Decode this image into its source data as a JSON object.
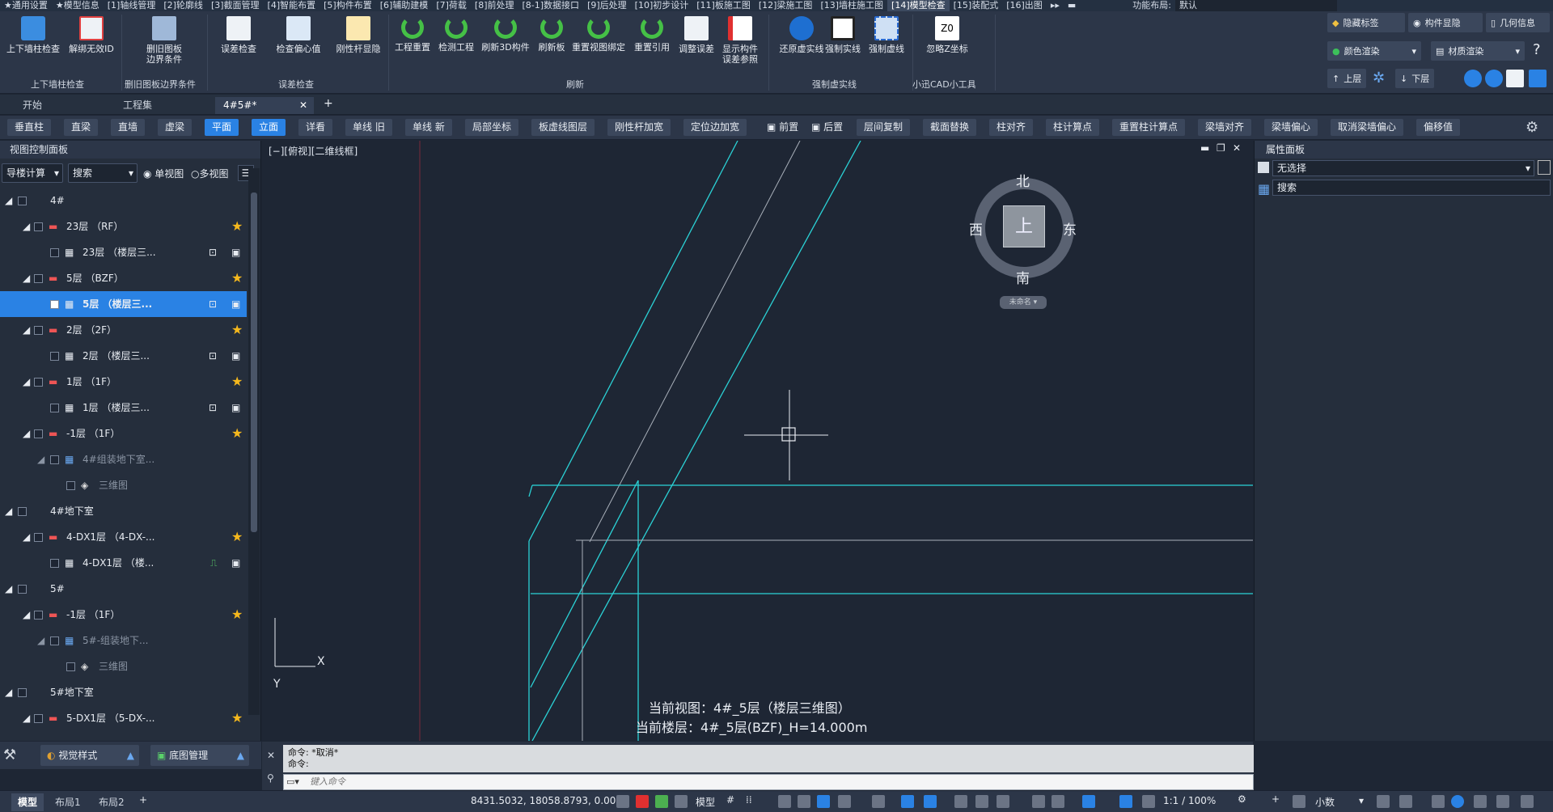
{
  "menu": [
    "★通用设置",
    "★模型信息",
    "[1]轴线管理",
    "[2]轮廓线",
    "[3]截面管理",
    "[4]智能布置",
    "[5]构件布置",
    "[6]辅助建模",
    "[7]荷载",
    "[8]前处理",
    "[8-1]数据接口",
    "[9]后处理",
    "[10]初步设计",
    "[11]板施工图",
    "[12]梁施工图",
    "[13]墙柱施工图",
    "[14]模型检查",
    "[15]装配式",
    "[16]出图"
  ],
  "menu_right": {
    "layout_label": "功能布局:",
    "layout_value": "默认"
  },
  "ribbon": {
    "buttons": {
      "b1": "上下墙柱检查",
      "b2": "解绑无效ID",
      "b3": "删旧图板\n边界条件",
      "b4": "误差检查",
      "b5": "检查偏心值",
      "b6": "刚性杆显隐",
      "b7": "工程重置",
      "b8": "检测工程",
      "b9": "刷新3D构件",
      "b10": "刷新板",
      "b11": "重置视图绑定",
      "b12": "重置引用",
      "b13": "调整误差",
      "b14": "显示构件\n误差参照",
      "b15": "还原虚实线",
      "b16": "强制实线",
      "b17": "强制虚线",
      "b18": "忽略Z坐标"
    },
    "groups": {
      "g1": "上下墙柱检查",
      "g2": "删旧图板边界条件",
      "g3": "误差检查",
      "g4": "刷新",
      "g5": "强制虚实线",
      "g6": "小迅CAD小工具"
    },
    "right": {
      "hide_tag": "隐藏标签",
      "comp_show": "构件显隐",
      "geo_info": "几何信息",
      "color_render": "颜色渲染",
      "mat_render": "材质渲染",
      "up_floor": "上层",
      "down_floor": "下层"
    }
  },
  "doctabs": {
    "t1": "开始",
    "t2": "工程集",
    "t3": "4#5#*"
  },
  "toolbar2": [
    "垂直柱",
    "直梁",
    "直墙",
    "虚梁",
    "平面",
    "立面",
    "详看",
    "单线 旧",
    "单线 新",
    "局部坐标",
    "板虚线图层",
    "刚性杆加宽",
    "定位边加宽",
    "前置",
    "后置",
    "层间复制",
    "截面替换",
    "柱对齐",
    "柱计算点",
    "重置柱计算点",
    "梁墙对齐",
    "梁墙偏心",
    "取消梁墙偏心",
    "偏移值"
  ],
  "left_panel": {
    "title": "视图控制面板",
    "dropdown": "导楼计算",
    "search": "搜索",
    "single_view": "单视图",
    "multi_view": "多视图",
    "tree": [
      {
        "label": "4#"
      },
      {
        "label": "23层 （RF）"
      },
      {
        "label": "23层 （楼层三..."
      },
      {
        "label": "5层 （BZF）"
      },
      {
        "label": "5层 （楼层三..."
      },
      {
        "label": "2层 （2F）"
      },
      {
        "label": "2层 （楼层三..."
      },
      {
        "label": "1层 （1F）"
      },
      {
        "label": "1层 （楼层三..."
      },
      {
        "label": "-1层 （1F）"
      },
      {
        "label": "4#组装地下室..."
      },
      {
        "label": "三维图"
      },
      {
        "label": "4#地下室"
      },
      {
        "label": "4-DX1层 （4-DX-..."
      },
      {
        "label": "4-DX1层 （楼..."
      },
      {
        "label": "5#"
      },
      {
        "label": "-1层 （1F）"
      },
      {
        "label": "5#-组装地下..."
      },
      {
        "label": "三维图"
      },
      {
        "label": "5#地下室"
      },
      {
        "label": "5-DX1层 （5-DX-..."
      }
    ],
    "visual_style": "视觉样式",
    "base_manage": "底图管理"
  },
  "canvas": {
    "view_label": "[−][俯视][二维线框]",
    "compass": {
      "n": "北",
      "s": "南",
      "w": "西",
      "e": "东",
      "top": "上",
      "unnamed": "未命名"
    },
    "current_view": "当前视图：4#_5层（楼层三维图）",
    "current_floor": "当前楼层：4#_5层(BZF)_H=14.000m",
    "axis_y": "Y",
    "axis_x": "X"
  },
  "right_panel": {
    "title": "属性面板",
    "selection": "无选择",
    "search": "搜索"
  },
  "command": {
    "line1": "命令: *取消*",
    "line2": "命令:",
    "placeholder": "键入命令"
  },
  "status": {
    "tab_model": "模型",
    "tab_l1": "布局1",
    "tab_l2": "布局2",
    "coords": "8431.5032, 18058.8793, 0.0000",
    "model": "模型",
    "scale": "1:1 / 100%",
    "units": "小数"
  }
}
